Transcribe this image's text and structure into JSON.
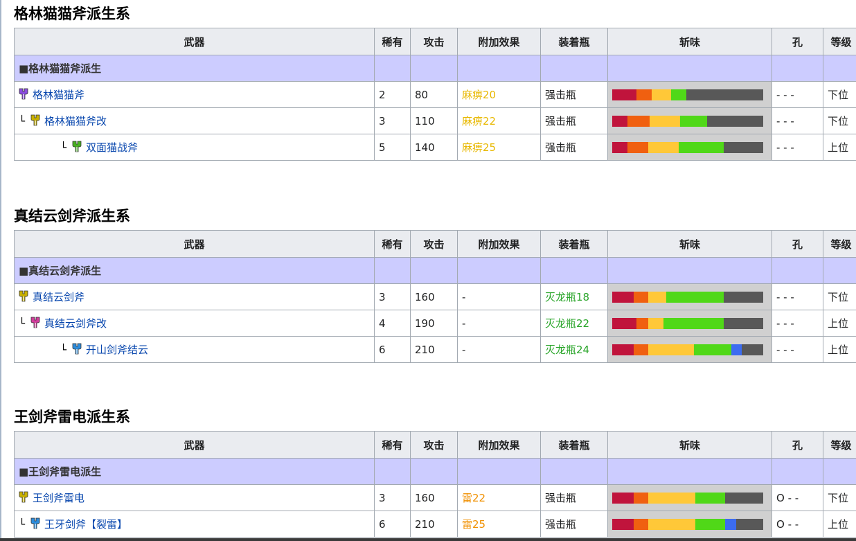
{
  "headers": [
    "武器",
    "稀有",
    "攻击",
    "附加效果",
    "装着瓶",
    "斩味",
    "孔",
    "等级"
  ],
  "sharpness_colors": {
    "red": "#c0143c",
    "orange": "#f06010",
    "yellow": "#ffc838",
    "green": "#50d818",
    "blue": "#3c6cf0",
    "white": "#f4f4f4",
    "gray": "#585858"
  },
  "sections": [
    {
      "title": "格林猫猫斧派生系",
      "group": "■格林猫猫斧派生",
      "rows": [
        {
          "prefix": "",
          "icon_color": "#8a4ce0",
          "name": "格林猫猫斧",
          "rarity": "2",
          "attack": "80",
          "effect": "麻痹20",
          "effect_color": "#e8b800",
          "phial": "强击瓶",
          "phial_color": "#202122",
          "slots": "- - -",
          "rank": "下位",
          "sharpness": [
            {
              "c": "red",
              "v": 0.16
            },
            {
              "c": "orange",
              "v": 0.1
            },
            {
              "c": "yellow",
              "v": 0.13
            },
            {
              "c": "green",
              "v": 0.1
            },
            {
              "c": "gray",
              "v": 0.51
            }
          ]
        },
        {
          "prefix": "└",
          "icon_color": "#c8b000",
          "name": "格林猫猫斧改",
          "rarity": "3",
          "attack": "110",
          "effect": "麻痹22",
          "effect_color": "#e8b800",
          "phial": "强击瓶",
          "phial_color": "#202122",
          "slots": "- - -",
          "rank": "下位",
          "sharpness": [
            {
              "c": "red",
              "v": 0.1
            },
            {
              "c": "orange",
              "v": 0.15
            },
            {
              "c": "yellow",
              "v": 0.2
            },
            {
              "c": "green",
              "v": 0.18
            },
            {
              "c": "gray",
              "v": 0.37
            }
          ]
        },
        {
          "prefix": "└",
          "icon_color": "#48b020",
          "name": "双面猫战斧",
          "rarity": "5",
          "attack": "140",
          "effect": "麻痹25",
          "effect_color": "#e8b800",
          "phial": "强击瓶",
          "phial_color": "#202122",
          "slots": "- - -",
          "rank": "上位",
          "sharpness": [
            {
              "c": "red",
              "v": 0.1
            },
            {
              "c": "orange",
              "v": 0.14
            },
            {
              "c": "yellow",
              "v": 0.2
            },
            {
              "c": "green",
              "v": 0.3
            },
            {
              "c": "gray",
              "v": 0.26
            }
          ]
        }
      ]
    },
    {
      "title": "真结云剑斧派生系",
      "group": "■真结云剑斧派生",
      "rows": [
        {
          "prefix": "",
          "icon_color": "#c8b000",
          "name": "真结云剑斧",
          "rarity": "3",
          "attack": "160",
          "effect": "-",
          "effect_color": "#202122",
          "phial": "灭龙瓶18",
          "phial_color": "#2aa52a",
          "slots": "- - -",
          "rank": "下位",
          "sharpness": [
            {
              "c": "red",
              "v": 0.14
            },
            {
              "c": "orange",
              "v": 0.1
            },
            {
              "c": "yellow",
              "v": 0.12
            },
            {
              "c": "green",
              "v": 0.38
            },
            {
              "c": "gray",
              "v": 0.26
            }
          ]
        },
        {
          "prefix": "└",
          "icon_color": "#d23c9c",
          "name": "真结云剑斧改",
          "rarity": "4",
          "attack": "190",
          "effect": "-",
          "effect_color": "#202122",
          "phial": "灭龙瓶22",
          "phial_color": "#2aa52a",
          "slots": "- - -",
          "rank": "上位",
          "sharpness": [
            {
              "c": "red",
              "v": 0.16
            },
            {
              "c": "orange",
              "v": 0.08
            },
            {
              "c": "yellow",
              "v": 0.1
            },
            {
              "c": "green",
              "v": 0.4
            },
            {
              "c": "gray",
              "v": 0.26
            }
          ]
        },
        {
          "prefix": "└",
          "icon_color": "#2c8cdc",
          "name": "开山剑斧结云",
          "rarity": "6",
          "attack": "210",
          "effect": "-",
          "effect_color": "#202122",
          "phial": "灭龙瓶24",
          "phial_color": "#2aa52a",
          "slots": "- - -",
          "rank": "上位",
          "sharpness": [
            {
              "c": "red",
              "v": 0.14
            },
            {
              "c": "orange",
              "v": 0.1
            },
            {
              "c": "yellow",
              "v": 0.3
            },
            {
              "c": "green",
              "v": 0.25
            },
            {
              "c": "blue",
              "v": 0.07
            },
            {
              "c": "gray",
              "v": 0.14
            }
          ]
        }
      ]
    },
    {
      "title": "王剑斧雷电派生系",
      "group": "■王剑斧雷电派生",
      "rows": [
        {
          "prefix": "",
          "icon_color": "#c8b000",
          "name": "王剑斧雷电",
          "rarity": "3",
          "attack": "160",
          "effect": "雷22",
          "effect_color": "#f09000",
          "phial": "强击瓶",
          "phial_color": "#202122",
          "slots": "O - -",
          "rank": "下位",
          "sharpness": [
            {
              "c": "red",
              "v": 0.14
            },
            {
              "c": "orange",
              "v": 0.1
            },
            {
              "c": "yellow",
              "v": 0.31
            },
            {
              "c": "green",
              "v": 0.2
            },
            {
              "c": "gray",
              "v": 0.25
            }
          ]
        },
        {
          "prefix": "└",
          "icon_color": "#2c8cdc",
          "name": "王牙剑斧【裂雷】",
          "rarity": "6",
          "attack": "210",
          "effect": "雷25",
          "effect_color": "#f09000",
          "phial": "强击瓶",
          "phial_color": "#202122",
          "slots": "O - -",
          "rank": "上位",
          "sharpness": [
            {
              "c": "red",
              "v": 0.14
            },
            {
              "c": "orange",
              "v": 0.1
            },
            {
              "c": "yellow",
              "v": 0.31
            },
            {
              "c": "green",
              "v": 0.2
            },
            {
              "c": "blue",
              "v": 0.07
            },
            {
              "c": "gray",
              "v": 0.18
            }
          ]
        }
      ]
    }
  ]
}
